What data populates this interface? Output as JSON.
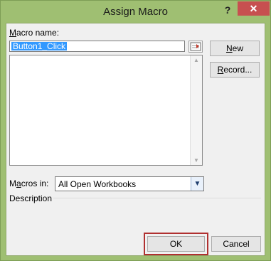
{
  "window": {
    "title": "Assign Macro",
    "help_glyph": "?",
    "close_glyph": "✕"
  },
  "form": {
    "macro_name_label_hotkey": "M",
    "macro_name_label_rest": "acro name:",
    "macro_name_value": "Button1_Click",
    "macros_in_label_pre": "M",
    "macros_in_label_hotkey": "a",
    "macros_in_label_rest": "cros in:",
    "macros_in_value": "All Open Workbooks",
    "description_label": "Description"
  },
  "buttons": {
    "new_hotkey": "N",
    "new_rest": "ew",
    "record_hotkey": "R",
    "record_rest": "ecord...",
    "ok": "OK",
    "cancel": "Cancel"
  },
  "colors": {
    "window_frame": "#9fbf72",
    "close_button": "#c75050",
    "selection": "#3399ff",
    "highlight_border": "#b03030"
  }
}
